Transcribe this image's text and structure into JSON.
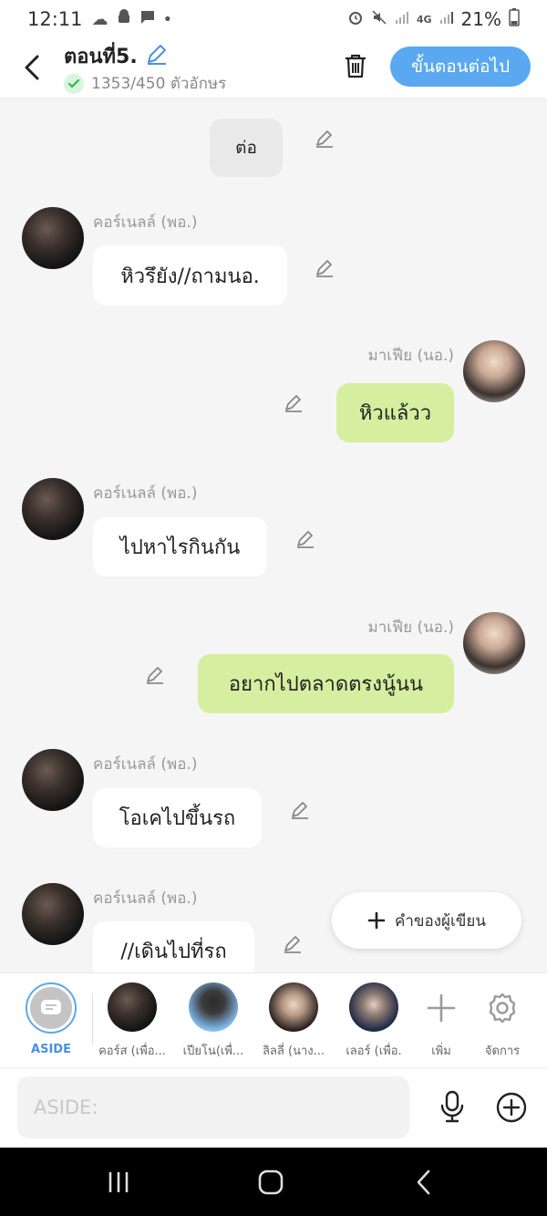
{
  "status_bar": {
    "time": "12:11",
    "network_label": "4G",
    "battery": "21%"
  },
  "header": {
    "title": "ตอนที่5.",
    "char_count": "1353/450 ตัวอักษร",
    "next_button": "ขั้นตอนต่อไป"
  },
  "messages": [
    {
      "type": "narration",
      "text": "ต่อ"
    },
    {
      "type": "left",
      "sender": "คอร์เนลล์ (พอ.)",
      "text": "หิวรึยัง//ถามนอ."
    },
    {
      "type": "right",
      "sender": "มาเฟีย (นอ.)",
      "text": "หิวแล้วว"
    },
    {
      "type": "left",
      "sender": "คอร์เนลล์ (พอ.)",
      "text": "ไปหาไรกินกัน"
    },
    {
      "type": "right",
      "sender": "มาเฟีย (นอ.)",
      "text": "อยากไปตลาดตรงนู้นน"
    },
    {
      "type": "left",
      "sender": "คอร์เนลล์ (พอ.)",
      "text": "โอเคไปขึ้นรถ"
    },
    {
      "type": "left",
      "sender": "คอร์เนลล์ (พอ.)",
      "text": "//เดินไปที่รถ"
    }
  ],
  "writer_button": {
    "label": "คำของผู้เขียน"
  },
  "character_bar": {
    "aside_label": "ASIDE",
    "characters": [
      {
        "label": "คอร์ส (เพื่อ..."
      },
      {
        "label": "เปียโน(เพื่..."
      },
      {
        "label": "ลิลลี่ (นาง..."
      },
      {
        "label": "เลอร์ (เพื่อ."
      }
    ],
    "add_label": "เพิ่ม",
    "manage_label": "จัดการ"
  },
  "input": {
    "placeholder": "ASIDE:",
    "value": ""
  },
  "colors": {
    "accent": "#5aa8ef",
    "green_bubble": "#d6eea0",
    "white_bubble": "#ffffff"
  }
}
